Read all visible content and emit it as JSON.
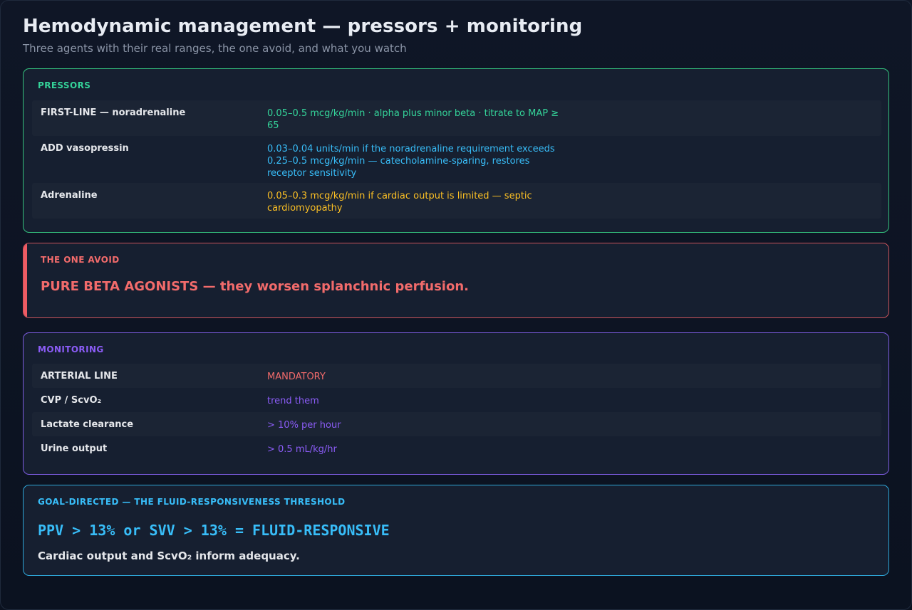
{
  "header": {
    "title": "Hemodynamic management — pressors + monitoring",
    "subtitle": "Three agents with their real ranges, the one avoid, and what you watch"
  },
  "pressors": {
    "label": "PRESSORS",
    "rows": [
      {
        "name": "FIRST-LINE — noradrenaline",
        "value": "0.05–0.5 mcg/kg/min · alpha plus minor beta · titrate to MAP ≥ 65",
        "color": "#34d399"
      },
      {
        "name": "ADD vasopressin",
        "value": "0.03–0.04 units/min if the noradrenaline requirement exceeds 0.25–0.5 mcg/kg/min — catecholamine-sparing, restores receptor sensitivity",
        "color": "#38bdf8"
      },
      {
        "name": "Adrenaline",
        "value": "0.05–0.3 mcg/kg/min if cardiac output is limited — septic cardiomyopathy",
        "color": "#fbbf24"
      }
    ]
  },
  "avoid": {
    "label": "THE ONE AVOID",
    "text": "PURE BETA AGONISTS — they worsen splanchnic perfusion.",
    "color": "#f26b6b"
  },
  "monitoring": {
    "label": "MONITORING",
    "rows": [
      {
        "name": "ARTERIAL LINE",
        "value": "MANDATORY",
        "color": "#f26b6b"
      },
      {
        "name": "CVP / ScvO₂",
        "value": "trend them",
        "color": "#8b5cf6"
      },
      {
        "name": "Lactate clearance",
        "value": "> 10% per hour",
        "color": "#8b5cf6"
      },
      {
        "name": "Urine output",
        "value": "> 0.5 mL/kg/hr",
        "color": "#8b5cf6"
      }
    ]
  },
  "goal": {
    "label": "GOAL-DIRECTED — THE FLUID-RESPONSIVENESS THRESHOLD",
    "formula": "PPV > 13% or SVV > 13% = FLUID-RESPONSIVE",
    "note": "Cardiac output and ScvO₂ inform adequacy."
  }
}
